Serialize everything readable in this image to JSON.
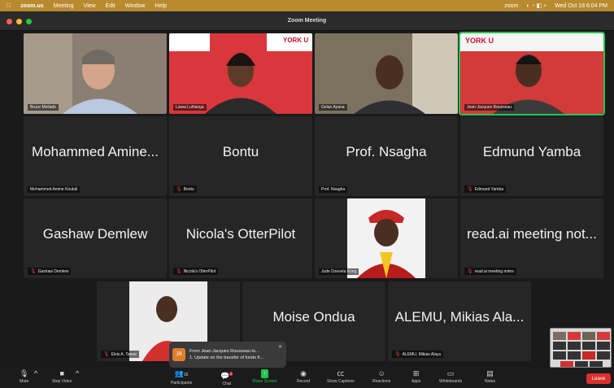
{
  "menubar": {
    "app": "zoom.us",
    "items": [
      "Meeting",
      "View",
      "Edit",
      "Window",
      "Help"
    ],
    "status_brand": "zoom",
    "clock": "Wed Oct 18 6:04 PM"
  },
  "window": {
    "title": "Zoom Meeting"
  },
  "participants": [
    {
      "name": "Bruce Mellado",
      "display": "",
      "muted": false,
      "video": true
    },
    {
      "name": "Liswa Luhlanga",
      "display": "",
      "muted": false,
      "video": true,
      "banner": "YORK U"
    },
    {
      "name": "Gelan Ayana",
      "display": "",
      "muted": false,
      "video": true
    },
    {
      "name": "Jean-Jacques Rousseau",
      "display": "",
      "muted": false,
      "video": true,
      "active": true,
      "banner": "YORK U"
    },
    {
      "name": "Mohammed Amine Koulali",
      "display": "Mohammed Amine...",
      "muted": false,
      "video": false
    },
    {
      "name": "Bontu",
      "display": "Bontu",
      "muted": true,
      "video": false
    },
    {
      "name": "Prof. Nsagha",
      "display": "Prof. Nsagha",
      "muted": false,
      "video": false
    },
    {
      "name": "Edmund Yamba",
      "display": "Edmund Yamba",
      "muted": true,
      "video": false
    },
    {
      "name": "Gashaw Demlew",
      "display": "Gashaw Demlew",
      "muted": true,
      "video": false
    },
    {
      "name": "Nicola's OtterPilot",
      "display": "Nicola's OtterPilot",
      "muted": true,
      "video": false
    },
    {
      "name": "Jude Dzevela Kong",
      "display": "",
      "muted": false,
      "video": true
    },
    {
      "name": "read.ai meeting notes",
      "display": "read.ai meeting not...",
      "muted": true,
      "video": false
    },
    {
      "name": "Elvis A. Tanue",
      "display": "",
      "muted": true,
      "video": true
    },
    {
      "name": "Moise Ondua",
      "display": "Moise Ondua",
      "muted": false,
      "video": false
    },
    {
      "name": "ALEMU, Mikias Alayu",
      "display": "ALEMU, Mikias Ala...",
      "muted": true,
      "video": false
    }
  ],
  "notification": {
    "initials": "JR",
    "from": "From Jean-Jacques Rousseau to...",
    "message": "1. Update on the transfer of funds fr..."
  },
  "toolbar": {
    "mute": "Mute",
    "stop_video": "Stop Video",
    "participants": "Participants",
    "participants_count": "16",
    "chat": "Chat",
    "chat_badge": "2",
    "share": "Share Screen",
    "record": "Record",
    "captions": "Show Captions",
    "reactions": "Reactions",
    "apps": "Apps",
    "whiteboards": "Whiteboards",
    "notes": "Notes",
    "leave": "Leave"
  },
  "colors": {
    "share_green": "#23c552",
    "leave_red": "#d9312e",
    "menubar": "#b98a2e"
  }
}
